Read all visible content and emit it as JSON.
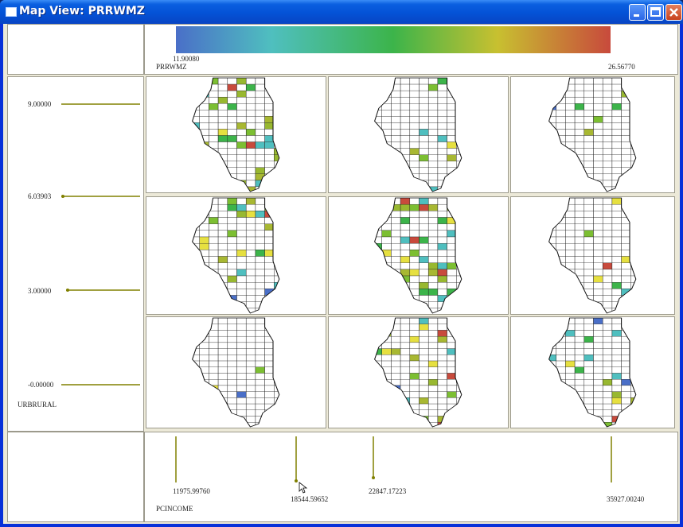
{
  "window": {
    "title": "Map View: PRRWMZ",
    "buttons": {
      "minimize": "minimize",
      "maximize": "maximize",
      "close": "close"
    }
  },
  "legend": {
    "variable": "PRRWMZ",
    "min_label": "11.90080",
    "max_label": "26.56770",
    "gradient_colors": [
      "#4a6fc8",
      "#4fbfbf",
      "#3cb44a",
      "#c8c030",
      "#c84a3c"
    ]
  },
  "y_axis": {
    "variable": "URBRURAL",
    "ticks": [
      "9.00000",
      "6.03903",
      "3.00000",
      "-0.00000"
    ]
  },
  "x_axis": {
    "variable": "PCINCOME",
    "ticks": [
      "11975.99760",
      "18544.59652",
      "22847.17223",
      "35927.00240"
    ]
  },
  "grid": {
    "rows": 3,
    "cols": 3
  },
  "colors": {
    "accent": "#808000",
    "window_title_bar": "#0452d6",
    "client_bg": "#ece9d8"
  }
}
